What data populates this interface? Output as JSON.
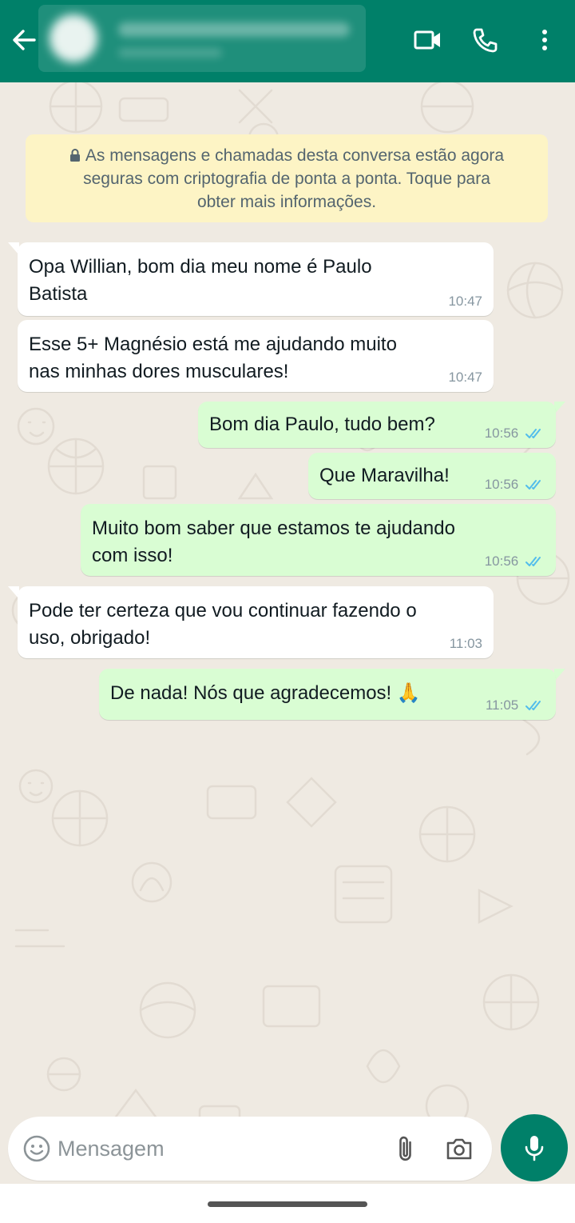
{
  "header": {
    "back_icon": "arrow-left-icon",
    "contact_name": "",
    "actions": [
      "video-call-icon",
      "phone-icon",
      "more-vertical-icon"
    ]
  },
  "encryption_notice": {
    "line1": "As mensagens e chamadas desta conversa estão agora",
    "line2": "seguras com criptografia de ponta a ponta. Toque para",
    "line3": "obter mais informações.",
    "icon": "lock-icon"
  },
  "messages": [
    {
      "direction": "in",
      "line1": "Opa Willian, bom dia meu nome é Paulo",
      "line2": "Batista",
      "time": "10:47"
    },
    {
      "direction": "in",
      "line1": "Esse 5+ Magnésio está me ajudando muito",
      "line2": "nas minhas dores musculares!",
      "time": "10:47"
    },
    {
      "direction": "out",
      "line1": "Bom dia Paulo, tudo bem?",
      "time": "10:56",
      "status": "read"
    },
    {
      "direction": "out",
      "line1": "Que Maravilha!",
      "time": "10:56",
      "status": "read"
    },
    {
      "direction": "out",
      "line1": "Muito bom saber que estamos te ajudando",
      "line2": "com isso!",
      "time": "10:56",
      "status": "read"
    },
    {
      "direction": "in",
      "line1": "Pode ter certeza que vou continuar fazendo o",
      "line2": "uso, obrigado!",
      "time": "11:03"
    },
    {
      "direction": "out",
      "line1": "De nada! Nós que agradecemos! 🙏",
      "time": "11:05",
      "status": "read"
    }
  ],
  "composer": {
    "placeholder": "Mensagem",
    "icons": [
      "emoji-icon",
      "attachment-icon",
      "camera-icon",
      "microphone-icon"
    ]
  },
  "colors": {
    "header": "#008069",
    "outgoing_bubble": "#d9fdd3",
    "incoming_bubble": "#ffffff",
    "notice": "#fdf4c5",
    "read_ticks": "#53bdeb",
    "chat_background": "#efeae2"
  }
}
